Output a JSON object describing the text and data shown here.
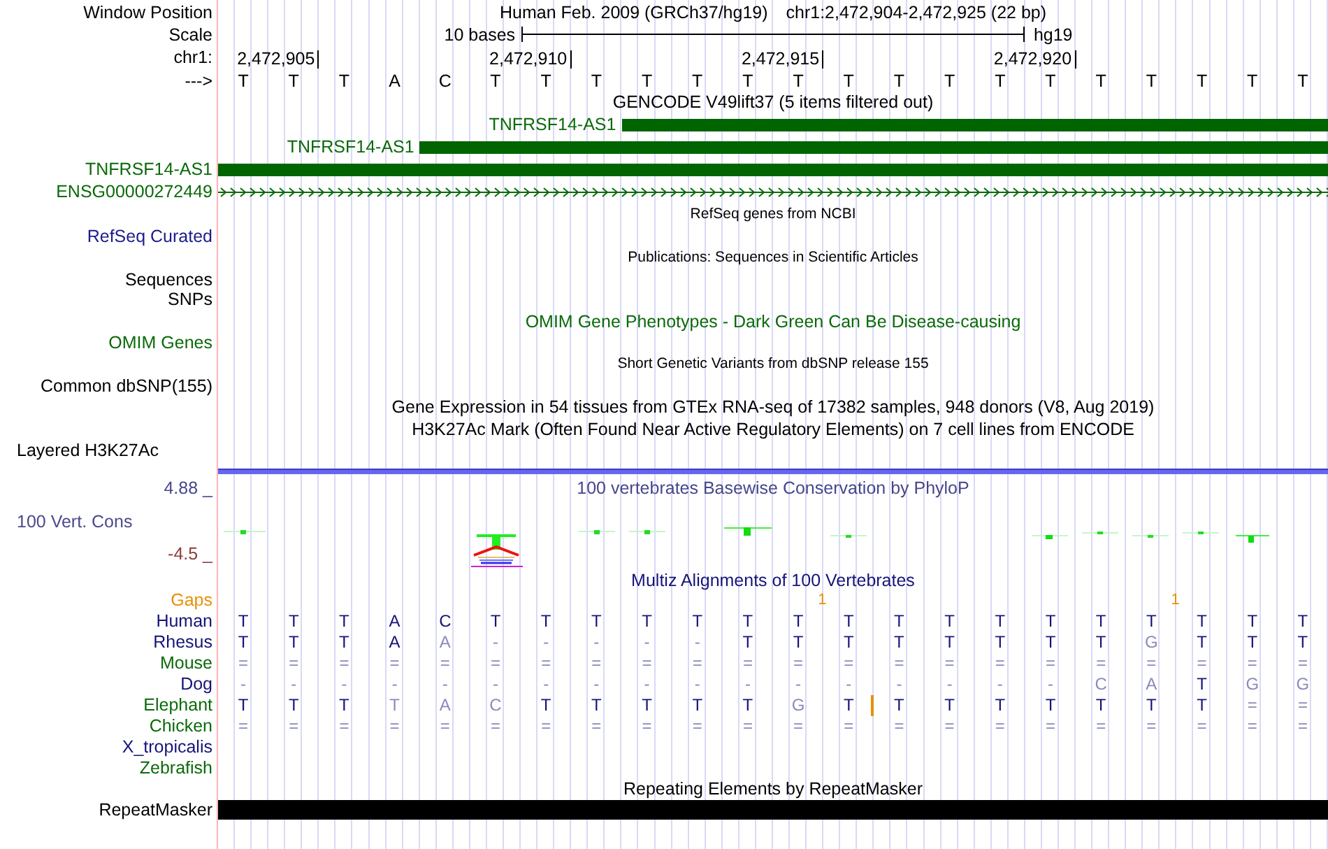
{
  "header": {
    "position_label": "Window Position",
    "assembly": "Human Feb. 2009 (GRCh37/hg19)",
    "range": "chr1:2,472,904-2,472,925 (22 bp)",
    "scale_label": "Scale",
    "scale_text": "10 bases",
    "scale_assembly": "hg19",
    "chrom_label": "chr1:",
    "ticks": [
      "2,472,905",
      "2,472,910",
      "2,472,915",
      "2,472,920"
    ],
    "strand_label": "--->",
    "bases": [
      "T",
      "T",
      "T",
      "A",
      "C",
      "T",
      "T",
      "T",
      "T",
      "T",
      "T",
      "T",
      "T",
      "T",
      "T",
      "T",
      "T",
      "T",
      "T",
      "T",
      "T",
      "T"
    ]
  },
  "gencode": {
    "title": "GENCODE V49lift37 (5 items filtered out)",
    "genes": [
      {
        "name": "TNFRSF14-AS1",
        "kind": "thick"
      },
      {
        "name": "TNFRSF14-AS1",
        "kind": "thick"
      },
      {
        "name": "TNFRSF14-AS1",
        "kind": "thick"
      },
      {
        "name": "ENSG00000272449",
        "kind": "line"
      }
    ]
  },
  "tracks": [
    {
      "kind": "small_title",
      "text": "RefSeq genes from NCBI",
      "color": "#000000"
    },
    {
      "kind": "label",
      "text": "RefSeq Curated",
      "color": "#1c1c8c"
    },
    {
      "kind": "small_title",
      "text": "Publications: Sequences in Scientific Articles",
      "color": "#000000"
    },
    {
      "kind": "label",
      "text": "Sequences",
      "color": "#000000"
    },
    {
      "kind": "label",
      "text": "SNPs",
      "color": "#000000"
    },
    {
      "kind": "title",
      "text": "OMIM Gene Phenotypes - Dark Green Can Be Disease-causing",
      "color": "#0a6a0a"
    },
    {
      "kind": "label",
      "text": "OMIM Genes",
      "color": "#0a6a0a"
    },
    {
      "kind": "small_title",
      "text": "Short Genetic Variants from dbSNP release 155",
      "color": "#000000"
    },
    {
      "kind": "label",
      "text": "Common dbSNP(155)",
      "color": "#000000"
    },
    {
      "kind": "title",
      "text": "Gene Expression in 54 tissues from GTEx RNA-seq of 17382 samples, 948 donors (V8, Aug 2019)",
      "color": "#000000"
    },
    {
      "kind": "title",
      "text": "H3K27Ac Mark (Often Found Near Active Regulatory Elements) on 7 cell lines from ENCODE",
      "color": "#000000"
    },
    {
      "kind": "left_label",
      "text": "Layered H3K27Ac",
      "color": "#000000"
    }
  ],
  "conservation": {
    "title": "100 vertebrates Basewise Conservation by PhyloP",
    "max": "4.88 _",
    "label": "100 Vert. Cons",
    "min": "-4.5 _"
  },
  "multiz": {
    "title": "Multiz Alignments of 100 Vertebrates",
    "gaps_label": "Gaps",
    "gaps": [
      {
        "count": "1"
      },
      {
        "count": "1"
      }
    ],
    "species": [
      {
        "name": "Human",
        "color": "#14147a",
        "cells": [
          {
            "text": "T",
            "conserved": true
          },
          {
            "text": "T",
            "conserved": true
          },
          {
            "text": "T",
            "conserved": true
          },
          {
            "text": "A",
            "conserved": true
          },
          {
            "text": "C",
            "conserved": true
          },
          {
            "text": "T",
            "conserved": true
          },
          {
            "text": "T",
            "conserved": true
          },
          {
            "text": "T",
            "conserved": true
          },
          {
            "text": "T",
            "conserved": true
          },
          {
            "text": "T",
            "conserved": true
          },
          {
            "text": "T",
            "conserved": true
          },
          {
            "text": "T",
            "conserved": true
          },
          {
            "text": "T",
            "conserved": true
          },
          {
            "text": "T",
            "conserved": true
          },
          {
            "text": "T",
            "conserved": true
          },
          {
            "text": "T",
            "conserved": true
          },
          {
            "text": "T",
            "conserved": true
          },
          {
            "text": "T",
            "conserved": true
          },
          {
            "text": "T",
            "conserved": true
          },
          {
            "text": "T",
            "conserved": true
          },
          {
            "text": "T",
            "conserved": true
          },
          {
            "text": "T",
            "conserved": true
          }
        ]
      },
      {
        "name": "Rhesus",
        "color": "#14147a",
        "cells": [
          {
            "text": "T",
            "conserved": true
          },
          {
            "text": "T",
            "conserved": true
          },
          {
            "text": "T",
            "conserved": true
          },
          {
            "text": "A",
            "conserved": true
          },
          {
            "text": "A",
            "conserved": false
          },
          {
            "text": "-",
            "conserved": false
          },
          {
            "text": "-",
            "conserved": false
          },
          {
            "text": "-",
            "conserved": false
          },
          {
            "text": "-",
            "conserved": false
          },
          {
            "text": "-",
            "conserved": false
          },
          {
            "text": "T",
            "conserved": true
          },
          {
            "text": "T",
            "conserved": true
          },
          {
            "text": "T",
            "conserved": true
          },
          {
            "text": "T",
            "conserved": true
          },
          {
            "text": "T",
            "conserved": true
          },
          {
            "text": "T",
            "conserved": true
          },
          {
            "text": "T",
            "conserved": true
          },
          {
            "text": "T",
            "conserved": true
          },
          {
            "text": "G",
            "conserved": false
          },
          {
            "text": "T",
            "conserved": true
          },
          {
            "text": "T",
            "conserved": true
          },
          {
            "text": "T",
            "conserved": true
          }
        ]
      },
      {
        "name": "Mouse",
        "color": "#0a6a0a",
        "cells": [
          {
            "text": "=",
            "conserved": false
          },
          {
            "text": "=",
            "conserved": false
          },
          {
            "text": "=",
            "conserved": false
          },
          {
            "text": "=",
            "conserved": false
          },
          {
            "text": "=",
            "conserved": false
          },
          {
            "text": "=",
            "conserved": false
          },
          {
            "text": "=",
            "conserved": false
          },
          {
            "text": "=",
            "conserved": false
          },
          {
            "text": "=",
            "conserved": false
          },
          {
            "text": "=",
            "conserved": false
          },
          {
            "text": "=",
            "conserved": false
          },
          {
            "text": "=",
            "conserved": false
          },
          {
            "text": "=",
            "conserved": false
          },
          {
            "text": "=",
            "conserved": false
          },
          {
            "text": "=",
            "conserved": false
          },
          {
            "text": "=",
            "conserved": false
          },
          {
            "text": "=",
            "conserved": false
          },
          {
            "text": "=",
            "conserved": false
          },
          {
            "text": "=",
            "conserved": false
          },
          {
            "text": "=",
            "conserved": false
          },
          {
            "text": "=",
            "conserved": false
          },
          {
            "text": "=",
            "conserved": false
          }
        ]
      },
      {
        "name": "Dog",
        "color": "#14147a",
        "cells": [
          {
            "text": "-",
            "conserved": false
          },
          {
            "text": "-",
            "conserved": false
          },
          {
            "text": "-",
            "conserved": false
          },
          {
            "text": "-",
            "conserved": false
          },
          {
            "text": "-",
            "conserved": false
          },
          {
            "text": "-",
            "conserved": false
          },
          {
            "text": "-",
            "conserved": false
          },
          {
            "text": "-",
            "conserved": false
          },
          {
            "text": "-",
            "conserved": false
          },
          {
            "text": "-",
            "conserved": false
          },
          {
            "text": "-",
            "conserved": false
          },
          {
            "text": "-",
            "conserved": false
          },
          {
            "text": "-",
            "conserved": false
          },
          {
            "text": "-",
            "conserved": false
          },
          {
            "text": "-",
            "conserved": false
          },
          {
            "text": "-",
            "conserved": false
          },
          {
            "text": "-",
            "conserved": false
          },
          {
            "text": "C",
            "conserved": false
          },
          {
            "text": "A",
            "conserved": false
          },
          {
            "text": "T",
            "conserved": true
          },
          {
            "text": "G",
            "conserved": false
          },
          {
            "text": "G",
            "conserved": false
          }
        ]
      },
      {
        "name": "Elephant",
        "color": "#0a6a0a",
        "cells": [
          {
            "text": "T",
            "conserved": true,
            "insertion": false
          },
          {
            "text": "T",
            "conserved": true,
            "insertion": false
          },
          {
            "text": "T",
            "conserved": true,
            "insertion": false
          },
          {
            "text": "T",
            "conserved": false,
            "insertion": false
          },
          {
            "text": "A",
            "conserved": false,
            "insertion": false
          },
          {
            "text": "C",
            "conserved": false,
            "insertion": false
          },
          {
            "text": "T",
            "conserved": true,
            "insertion": false
          },
          {
            "text": "T",
            "conserved": true,
            "insertion": false
          },
          {
            "text": "T",
            "conserved": true,
            "insertion": false
          },
          {
            "text": "T",
            "conserved": true,
            "insertion": false
          },
          {
            "text": "T",
            "conserved": true,
            "insertion": false
          },
          {
            "text": "G",
            "conserved": false,
            "insertion": false
          },
          {
            "text": "T",
            "conserved": true,
            "insertion": true
          },
          {
            "text": "T",
            "conserved": true,
            "insertion": false
          },
          {
            "text": "T",
            "conserved": true,
            "insertion": false
          },
          {
            "text": "T",
            "conserved": true,
            "insertion": false
          },
          {
            "text": "T",
            "conserved": true,
            "insertion": false
          },
          {
            "text": "T",
            "conserved": true,
            "insertion": false
          },
          {
            "text": "T",
            "conserved": true,
            "insertion": false
          },
          {
            "text": "T",
            "conserved": true,
            "insertion": false
          },
          {
            "text": "=",
            "conserved": false,
            "insertion": false
          },
          {
            "text": "=",
            "conserved": false,
            "insertion": false
          }
        ]
      },
      {
        "name": "Chicken",
        "color": "#0a6a0a",
        "cells": [
          {
            "text": "=",
            "conserved": false
          },
          {
            "text": "=",
            "conserved": false
          },
          {
            "text": "=",
            "conserved": false
          },
          {
            "text": "=",
            "conserved": false
          },
          {
            "text": "=",
            "conserved": false
          },
          {
            "text": "=",
            "conserved": false
          },
          {
            "text": "=",
            "conserved": false
          },
          {
            "text": "=",
            "conserved": false
          },
          {
            "text": "=",
            "conserved": false
          },
          {
            "text": "=",
            "conserved": false
          },
          {
            "text": "=",
            "conserved": false
          },
          {
            "text": "=",
            "conserved": false
          },
          {
            "text": "=",
            "conserved": false
          },
          {
            "text": "=",
            "conserved": false
          },
          {
            "text": "=",
            "conserved": false
          },
          {
            "text": "=",
            "conserved": false
          },
          {
            "text": "=",
            "conserved": false
          },
          {
            "text": "=",
            "conserved": false
          },
          {
            "text": "=",
            "conserved": false
          },
          {
            "text": "=",
            "conserved": false
          },
          {
            "text": "=",
            "conserved": false
          },
          {
            "text": "=",
            "conserved": false
          }
        ]
      },
      {
        "name": "X_tropicalis",
        "color": "#14147a"
      },
      {
        "name": "Zebrafish",
        "color": "#0a6a0a"
      }
    ]
  },
  "repeats": {
    "title": "Repeating Elements by RepeatMasker",
    "label": "RepeatMasker"
  }
}
